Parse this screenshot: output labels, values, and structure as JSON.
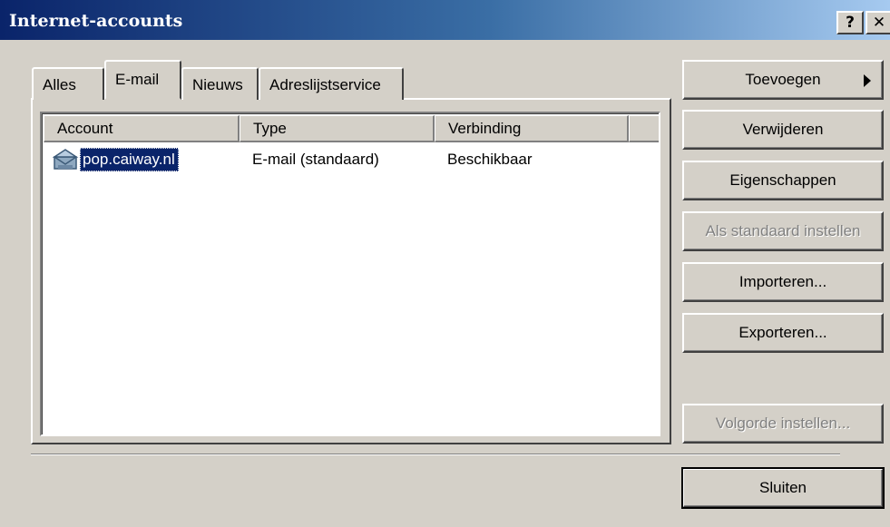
{
  "window": {
    "title": "Internet-accounts",
    "help_glyph": "?",
    "close_glyph": "✕"
  },
  "tabs": [
    {
      "label": "Alles"
    },
    {
      "label": "E-mail",
      "selected": true
    },
    {
      "label": "Nieuws"
    },
    {
      "label": "Adreslijstservice"
    }
  ],
  "list": {
    "columns": [
      "Account",
      "Type",
      "Verbinding"
    ],
    "rows": [
      {
        "account": "pop.caiway.nl",
        "type": "E-mail (standaard)",
        "connection": "Beschikbaar",
        "selected": true,
        "icon": "mail-account-icon"
      }
    ]
  },
  "buttons": {
    "add": "Toevoegen",
    "remove": "Verwijderen",
    "properties": "Eigenschappen",
    "set_default": "Als standaard instellen",
    "import": "Importeren...",
    "export": "Exporteren...",
    "set_order": "Volgorde instellen...",
    "close": "Sluiten"
  },
  "colors": {
    "titlebar_start": "#0a246a",
    "titlebar_end": "#a6caf0",
    "selection": "#0a246a",
    "face": "#d4d0c8"
  }
}
